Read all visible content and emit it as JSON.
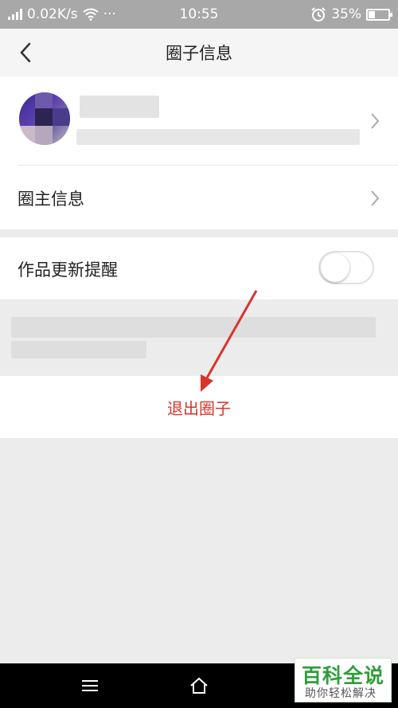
{
  "status_bar": {
    "network_speed": "0.02K/s",
    "dots": "···",
    "time": "10:55",
    "battery_percent": "35%",
    "battery_level": 0.35
  },
  "nav": {
    "title": "圈子信息"
  },
  "menu": {
    "owner_info": "圈主信息",
    "update_notify": "作品更新提醒",
    "update_notify_on": false,
    "exit": "退出圈子"
  },
  "watermark": {
    "title": "百科全说",
    "subtitle": "助你轻松解决"
  },
  "colors": {
    "accent_red": "#d9342b",
    "watermark_green": "#2e9e3a"
  }
}
